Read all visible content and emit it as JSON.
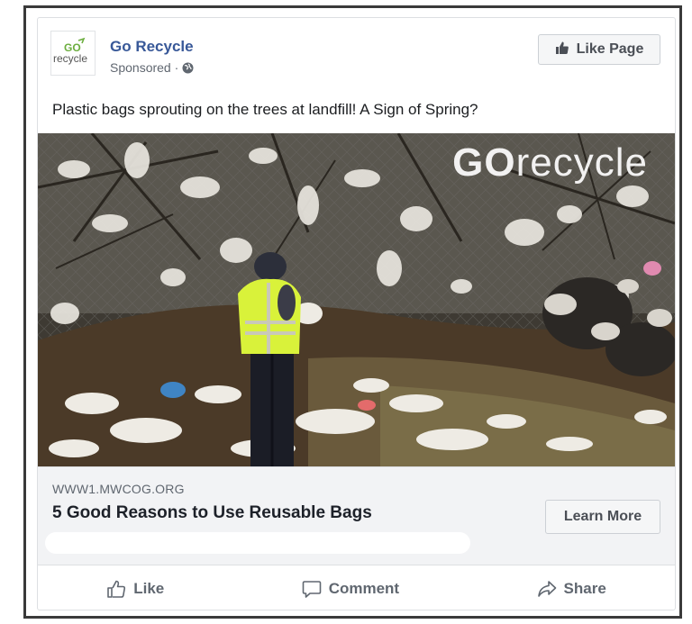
{
  "post": {
    "page_name": "Go Recycle",
    "logo_text_top": "GO",
    "logo_text_bottom": "recycle",
    "sponsored": "Sponsored ·",
    "like_page_label": "Like Page",
    "text": "Plastic bags sprouting on the trees at landfill! A Sign of Spring?"
  },
  "image": {
    "watermark_go": "GO",
    "watermark_recycle": "recycle"
  },
  "link": {
    "domain": "WWW1.MWCOG.ORG",
    "headline": "5 Good Reasons to Use Reusable Bags",
    "cta_label": "Learn More"
  },
  "actions": {
    "like": "Like",
    "comment": "Comment",
    "share": "Share"
  },
  "colors": {
    "page_name": "#385898",
    "muted": "#606770",
    "link_bg": "#f2f3f5",
    "logo_green": "#6cae3f"
  }
}
